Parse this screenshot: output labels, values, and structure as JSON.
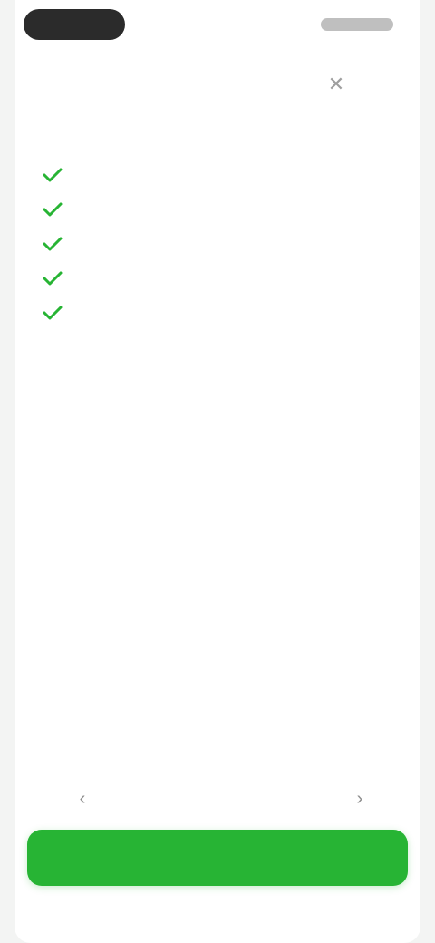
{
  "steps_section": {
    "title": "",
    "items": [
      {
        "title": "",
        "description": ""
      },
      {
        "title": "",
        "description": ""
      },
      {
        "title": "",
        "description": ""
      },
      {
        "title": "",
        "description": ""
      },
      {
        "title": "",
        "description": ""
      }
    ]
  },
  "pager": {
    "label": "",
    "prev_icon": "chevron-left-icon",
    "next_icon": "chevron-right-icon"
  },
  "primary_button": {
    "label": ""
  },
  "icons": {
    "close": "close-icon",
    "step_marker": "check-icon"
  },
  "colors": {
    "accent": "#27b434",
    "step_line": "#e3f3e3",
    "background": "#f3f4f3"
  }
}
